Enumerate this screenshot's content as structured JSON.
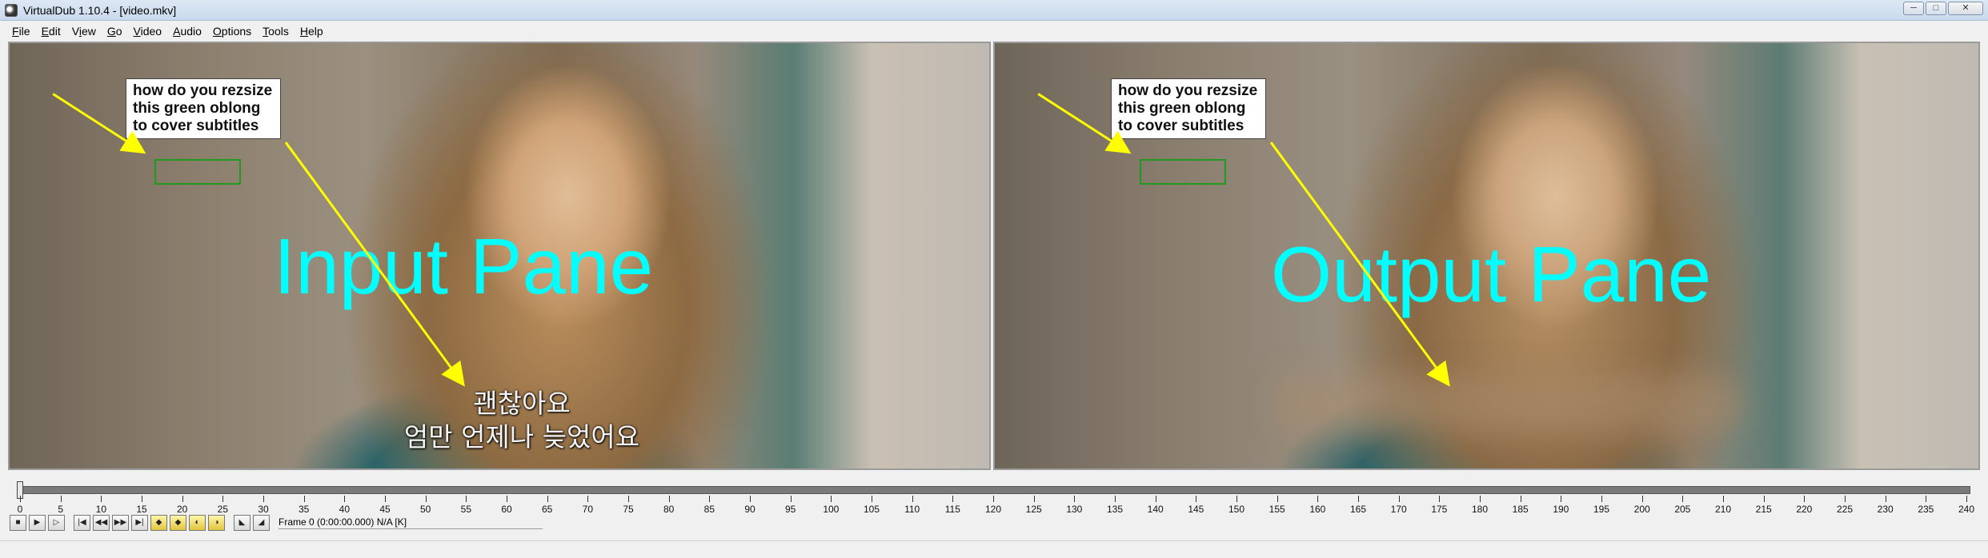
{
  "window": {
    "title": "VirtualDub 1.10.4 - [video.mkv]",
    "minimize": "─",
    "maximize": "□",
    "close": "✕"
  },
  "menu": [
    {
      "label": "File",
      "mnemonic": "F",
      "rest": "ile"
    },
    {
      "label": "Edit",
      "mnemonic": "E",
      "rest": "dit"
    },
    {
      "label": "View",
      "pre": "V",
      "mnemonic": "i",
      "rest": "ew"
    },
    {
      "label": "Go",
      "mnemonic": "G",
      "rest": "o"
    },
    {
      "label": "Video",
      "mnemonic": "V",
      "rest": "ideo"
    },
    {
      "label": "Audio",
      "mnemonic": "A",
      "rest": "udio"
    },
    {
      "label": "Options",
      "mnemonic": "O",
      "rest": "ptions"
    },
    {
      "label": "Tools",
      "mnemonic": "T",
      "rest": "ools"
    },
    {
      "label": "Help",
      "mnemonic": "H",
      "rest": "elp"
    }
  ],
  "annotation": {
    "lines": [
      "how do you rezsize",
      "this green oblong",
      "to cover subtitles"
    ]
  },
  "input_pane": {
    "label": "Input Pane",
    "subtitle_line1": "괜찮아요",
    "subtitle_line2": "엄만 언제나 늦었어요"
  },
  "output_pane": {
    "label": "Output Pane"
  },
  "timeline": {
    "ticks": [
      "0",
      "5",
      "10",
      "15",
      "20",
      "25",
      "30",
      "35",
      "40",
      "45",
      "50",
      "55",
      "60",
      "65",
      "70",
      "75",
      "80",
      "85",
      "90",
      "95",
      "100",
      "105",
      "110",
      "115",
      "120",
      "125",
      "130",
      "135",
      "140",
      "145",
      "150",
      "155",
      "160",
      "165",
      "170",
      "175",
      "180",
      "185",
      "190",
      "195",
      "200",
      "205",
      "210",
      "215",
      "220",
      "225",
      "230",
      "235",
      "240"
    ],
    "position_fraction": 0
  },
  "toolbar": {
    "frame_status": "Frame 0 (0:00:00.000) N/A [K]"
  },
  "colors": {
    "pane_label": "#00ffff",
    "arrow": "#ffff00",
    "green_box": "#1f9a1f"
  }
}
